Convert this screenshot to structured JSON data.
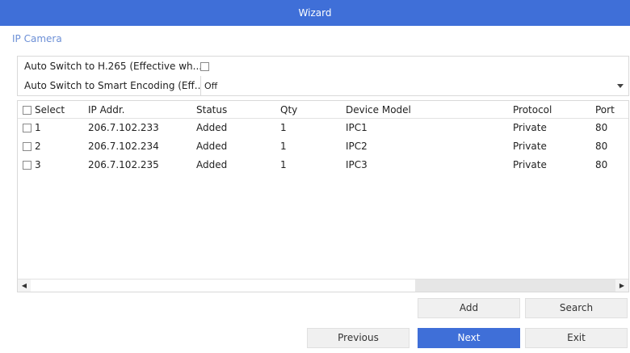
{
  "window": {
    "title": "Wizard"
  },
  "section": {
    "title": "IP Camera"
  },
  "form": {
    "h265_label": "Auto Switch to H.265 (Effective wh...",
    "h265_checked": false,
    "smart_label": "Auto Switch to Smart Encoding (Eff...",
    "smart_value": "Off"
  },
  "table": {
    "columns": {
      "select": "Select",
      "ip": "IP Addr.",
      "status": "Status",
      "qty": "Qty",
      "model": "Device Model",
      "protocol": "Protocol",
      "port": "Port"
    },
    "rows": [
      {
        "num": "1",
        "ip": "206.7.102.233",
        "status": "Added",
        "qty": "1",
        "model": "IPC1",
        "protocol": "Private",
        "port": "80"
      },
      {
        "num": "2",
        "ip": "206.7.102.234",
        "status": "Added",
        "qty": "1",
        "model": "IPC2",
        "protocol": "Private",
        "port": "80"
      },
      {
        "num": "3",
        "ip": "206.7.102.235",
        "status": "Added",
        "qty": "1",
        "model": "IPC3",
        "protocol": "Private",
        "port": "80"
      }
    ]
  },
  "scrollbar": {
    "left_glyph": "◀",
    "right_glyph": "▶"
  },
  "buttons": {
    "add": "Add",
    "search": "Search",
    "previous": "Previous",
    "next": "Next",
    "exit": "Exit"
  },
  "colors": {
    "accent": "#3f6fd8",
    "section_title": "#6c8fd6"
  }
}
